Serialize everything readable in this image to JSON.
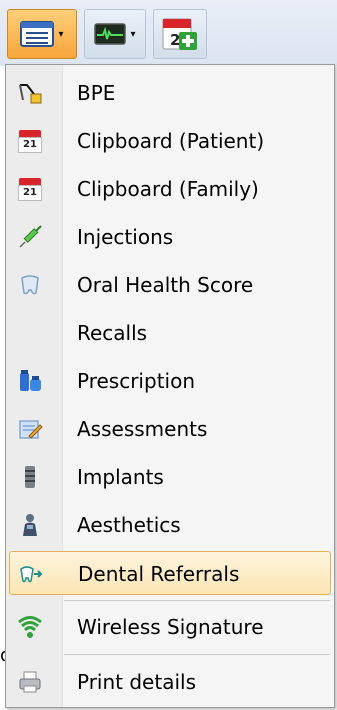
{
  "toolbar": {
    "buttons": [
      {
        "name": "list-view-button",
        "icon": "list-window-icon",
        "has_dropdown": true,
        "active": true
      },
      {
        "name": "monitor-button",
        "icon": "heart-monitor-icon",
        "has_dropdown": true,
        "active": false
      },
      {
        "name": "calendar-add-button",
        "icon": "calendar-add-icon",
        "has_dropdown": false,
        "active": false
      }
    ],
    "caret": "▾"
  },
  "menu": {
    "items": [
      {
        "label": "BPE",
        "icon": "bpe-probe-icon"
      },
      {
        "label": "Clipboard (Patient)",
        "icon": "calendar-icon",
        "icon_text": "21"
      },
      {
        "label": "Clipboard (Family)",
        "icon": "calendar-icon",
        "icon_text": "21"
      },
      {
        "label": "Injections",
        "icon": "syringe-icon"
      },
      {
        "label": "Oral Health Score",
        "icon": "tooth-icon"
      },
      {
        "label": "Recalls",
        "icon": ""
      },
      {
        "label": "Prescription",
        "icon": "medicine-bottles-icon"
      },
      {
        "label": "Assessments",
        "icon": "notepad-pencil-icon"
      },
      {
        "label": "Implants",
        "icon": "implant-screw-icon"
      },
      {
        "label": "Aesthetics",
        "icon": "aesthetics-figure-icon"
      },
      {
        "label": "Dental Referrals",
        "icon": "referral-tooth-icon",
        "highlighted": true
      },
      {
        "label": "Wireless Signature",
        "icon": "wireless-signal-icon"
      },
      {
        "label": "Print details",
        "icon": "printer-icon"
      }
    ]
  },
  "colors": {
    "highlight_border": "#e4b15b",
    "highlight_fill": "#fbe5b4",
    "active_button": "#f7a53c"
  }
}
